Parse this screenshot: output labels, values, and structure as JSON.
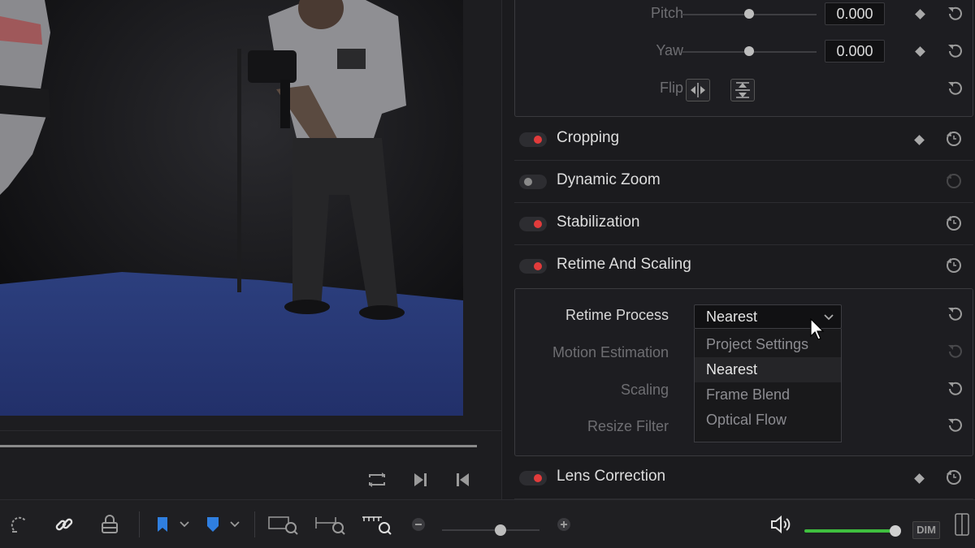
{
  "transform": {
    "pitch": {
      "label": "Pitch",
      "value": "0.000",
      "slider_fraction": 0.5
    },
    "yaw": {
      "label": "Yaw",
      "value": "0.000",
      "slider_fraction": 0.5
    },
    "flip": {
      "label": "Flip",
      "icons": [
        "flip-horizontal-icon",
        "flip-vertical-icon"
      ]
    }
  },
  "sections": [
    {
      "title": "Cropping",
      "enabled": true,
      "has_keyframe": true
    },
    {
      "title": "Dynamic Zoom",
      "enabled": false,
      "has_keyframe": false
    },
    {
      "title": "Stabilization",
      "enabled": true,
      "has_keyframe": false
    },
    {
      "title": "Retime And Scaling",
      "enabled": true,
      "has_keyframe": false
    },
    {
      "title": "Lens Correction",
      "enabled": true,
      "has_keyframe": true
    }
  ],
  "retime": {
    "process_label": "Retime Process",
    "process_value": "Nearest",
    "motion_estimation_label": "Motion Estimation",
    "scaling_label": "Scaling",
    "resize_filter_label": "Resize Filter",
    "options": [
      "Project Settings",
      "Nearest",
      "Frame Blend",
      "Optical Flow"
    ],
    "selected_option": "Nearest"
  },
  "toolbar": {
    "dim_label": "DIM",
    "zoom_fraction": 0.6,
    "volume_fraction": 1.0,
    "icons": [
      "snap-icon",
      "link-icon",
      "lock-track-icon",
      "flag-marker-icon",
      "shield-marker-icon",
      "zoom-fit-icon",
      "zoom-detail-icon",
      "zoom-custom-icon",
      "zoom-out-icon",
      "zoom-in-icon",
      "volume-icon"
    ]
  },
  "viewer": {
    "transport_icons": [
      "loop-icon",
      "next-frame-icon",
      "previous-frame-icon"
    ]
  },
  "colors": {
    "toggle_on": "#e23b3b",
    "volume_bar": "#3fbf3f",
    "marker_blue": "#2f7fe0",
    "mat_blue": "#2a3f80"
  }
}
